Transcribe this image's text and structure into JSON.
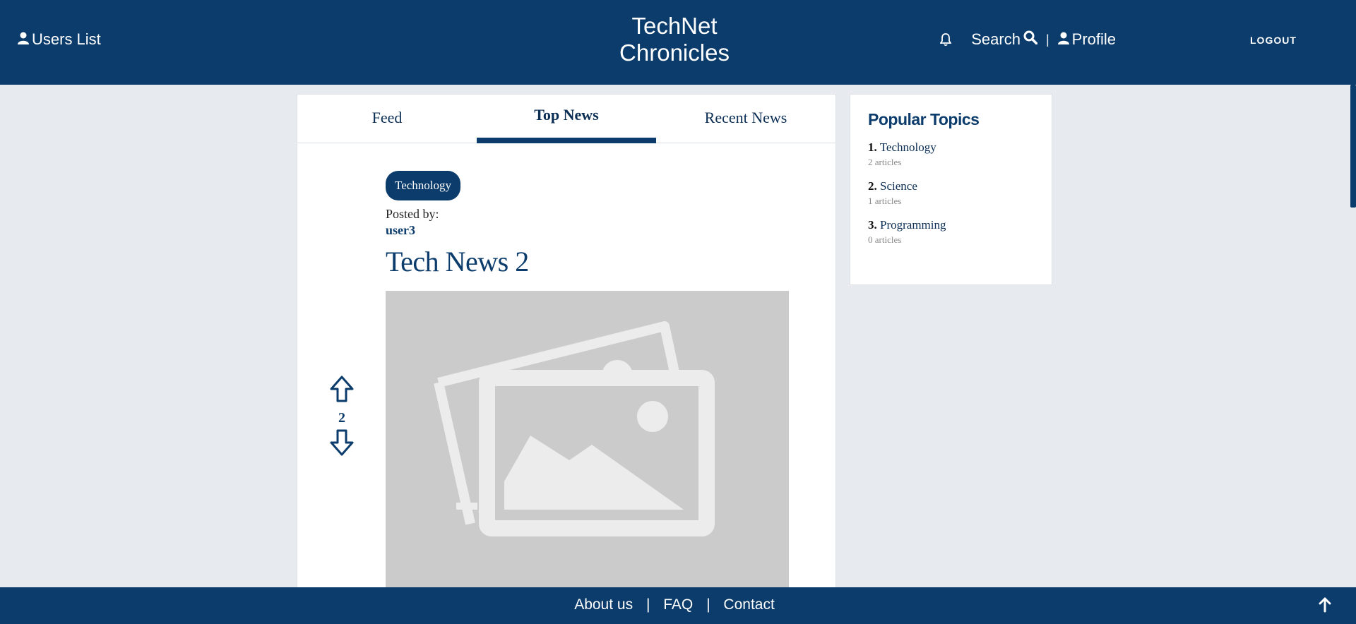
{
  "header": {
    "users_label": "Users List",
    "brand_line1": "TechNet",
    "brand_line2": "Chronicles",
    "search_label": "Search",
    "separator": "|",
    "profile_label": "Profile",
    "logout_label": "LOGOUT",
    "icons": [
      "user-icon",
      "bell-icon",
      "search-icon",
      "user-icon"
    ]
  },
  "tabs": [
    {
      "label": "Feed",
      "active": false
    },
    {
      "label": "Top News",
      "active": true
    },
    {
      "label": "Recent News",
      "active": false
    }
  ],
  "post": {
    "category": "Technology",
    "posted_by_label": "Posted by:",
    "author": "user3",
    "title": "Tech News 2",
    "votes": "2",
    "image": "placeholder-image-icon"
  },
  "sidebar": {
    "title": "Popular Topics",
    "topics": [
      {
        "rank": "1.",
        "name": "Technology",
        "count": "2 articles"
      },
      {
        "rank": "2.",
        "name": "Science",
        "count": "1 articles"
      },
      {
        "rank": "3.",
        "name": "Programming",
        "count": "0 articles"
      }
    ]
  },
  "footer": {
    "links": [
      "About us",
      "FAQ",
      "Contact"
    ],
    "separator": "|"
  },
  "colors": {
    "primary": "#0b3c6c",
    "background": "#e7ebef",
    "placeholder": "#cbcbcb"
  }
}
